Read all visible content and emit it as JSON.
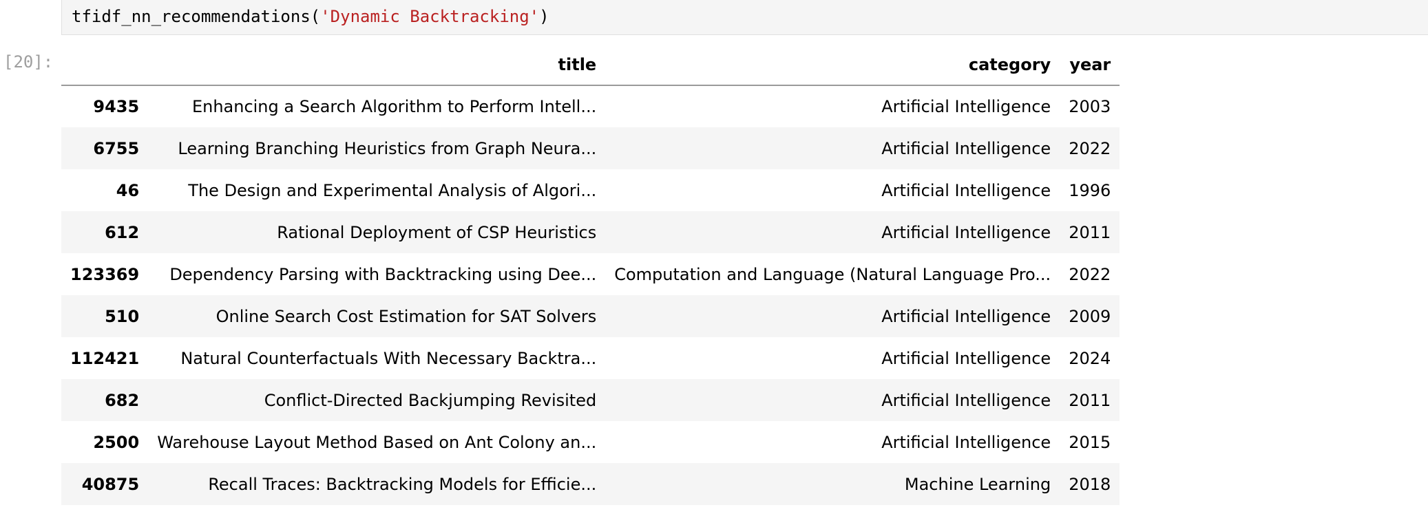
{
  "cell": {
    "code_func": "tfidf_nn_recommendations(",
    "code_arg": "'Dynamic Backtracking'",
    "code_close": ")",
    "prompt": "[20]:"
  },
  "table": {
    "columns": [
      "",
      "title",
      "category",
      "year"
    ],
    "rows": [
      {
        "index": "9435",
        "title": "Enhancing a Search Algorithm to Perform Intell...",
        "category": "Artificial Intelligence",
        "year": "2003"
      },
      {
        "index": "6755",
        "title": "Learning Branching Heuristics from Graph Neura...",
        "category": "Artificial Intelligence",
        "year": "2022"
      },
      {
        "index": "46",
        "title": "The Design and Experimental Analysis of Algori...",
        "category": "Artificial Intelligence",
        "year": "1996"
      },
      {
        "index": "612",
        "title": "Rational Deployment of CSP Heuristics",
        "category": "Artificial Intelligence",
        "year": "2011"
      },
      {
        "index": "123369",
        "title": "Dependency Parsing with Backtracking using Dee...",
        "category": "Computation and Language (Natural Language Pro...",
        "year": "2022"
      },
      {
        "index": "510",
        "title": "Online Search Cost Estimation for SAT Solvers",
        "category": "Artificial Intelligence",
        "year": "2009"
      },
      {
        "index": "112421",
        "title": "Natural Counterfactuals With Necessary Backtra...",
        "category": "Artificial Intelligence",
        "year": "2024"
      },
      {
        "index": "682",
        "title": "Conflict-Directed Backjumping Revisited",
        "category": "Artificial Intelligence",
        "year": "2011"
      },
      {
        "index": "2500",
        "title": "Warehouse Layout Method Based on Ant Colony an...",
        "category": "Artificial Intelligence",
        "year": "2015"
      },
      {
        "index": "40875",
        "title": "Recall Traces: Backtracking Models for Efficie...",
        "category": "Machine Learning",
        "year": "2018"
      }
    ]
  },
  "colors": {
    "string_literal": "#ba2121",
    "prompt": "#9e9e9e",
    "cell_background": "#f5f5f5",
    "stripe_row": "#f5f5f5"
  }
}
